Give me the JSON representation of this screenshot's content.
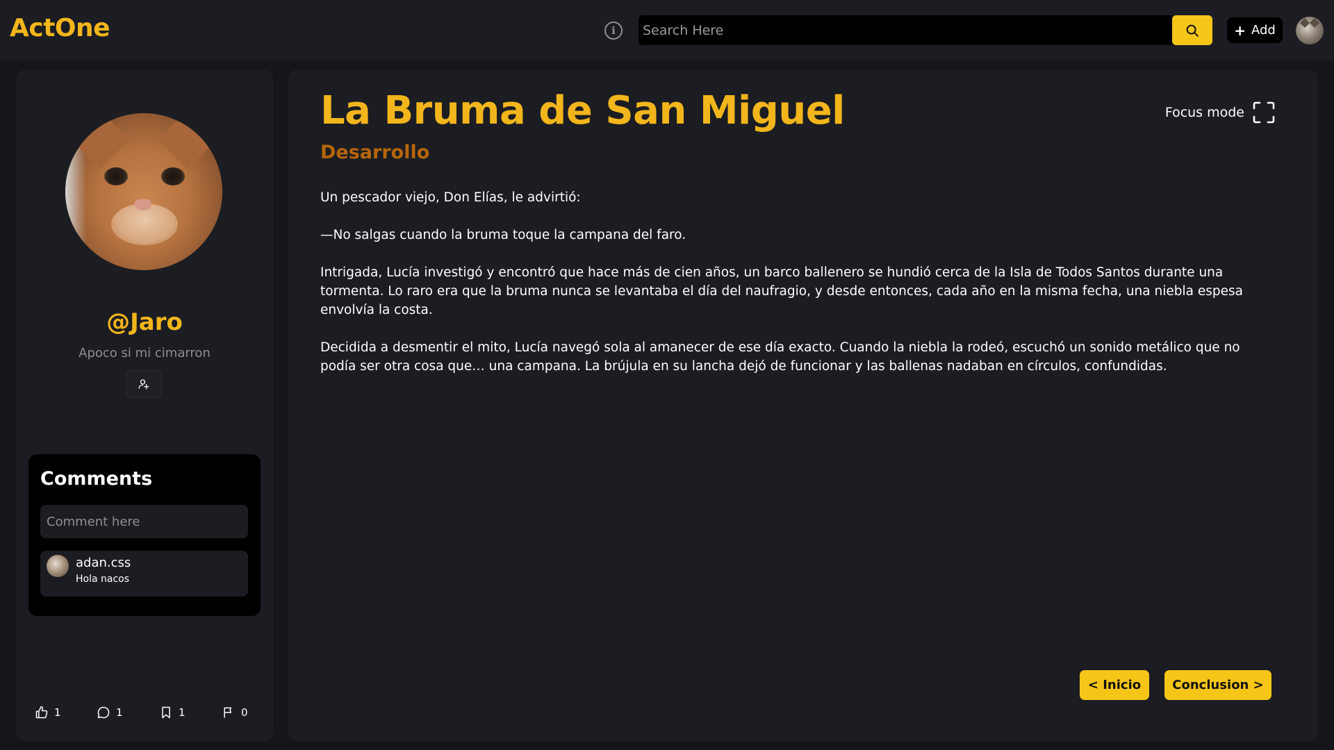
{
  "app": {
    "name": "ActOne"
  },
  "header": {
    "search_placeholder": "Search Here",
    "add_label": "Add",
    "add_symbol": "+",
    "info_symbol": "i",
    "icons": {
      "info": "info-icon",
      "search": "search-icon",
      "avatar": "user-avatar"
    }
  },
  "colors": {
    "accent": "#f5c518",
    "brand": "#f2b51c",
    "chapter": "#b5650a",
    "background": "#15161a",
    "panel": "#1c1d22"
  },
  "profile": {
    "username": "@Jaro",
    "bio": "Apoco si mi cimarron",
    "follow_icon": "add-user-icon"
  },
  "comments": {
    "title": "Comments",
    "input_placeholder": "Comment here",
    "items": [
      {
        "user": "adan.css",
        "text": "Hola nacos"
      }
    ]
  },
  "stats": {
    "likes": "1",
    "comments": "1",
    "bookmarks": "1",
    "flags": "0"
  },
  "story": {
    "title": "La Bruma de San Miguel",
    "chapter": "Desarrollo",
    "focus_label": "Focus mode",
    "paragraphs": [
      "Un pescador viejo, Don Elías, le advirtió:",
      "—No salgas cuando la bruma toque la campana del faro.",
      "Intrigada, Lucía investigó y encontró que hace más de cien años, un barco ballenero se hundió cerca de la Isla de Todos Santos durante una tormenta. Lo raro era que la bruma nunca se levantaba el día del naufragio, y desde entonces, cada año en la misma fecha, una niebla espesa envolvía la costa.",
      "Decidida a desmentir el mito, Lucía navegó sola al amanecer de ese día exacto. Cuando la niebla la rodeó, escuchó un sonido metálico que no podía ser otra cosa que… una campana. La brújula en su lancha dejó de funcionar y las ballenas nadaban en círculos, confundidas."
    ],
    "prev_label": "< Inicio",
    "next_label": "Conclusion >"
  }
}
